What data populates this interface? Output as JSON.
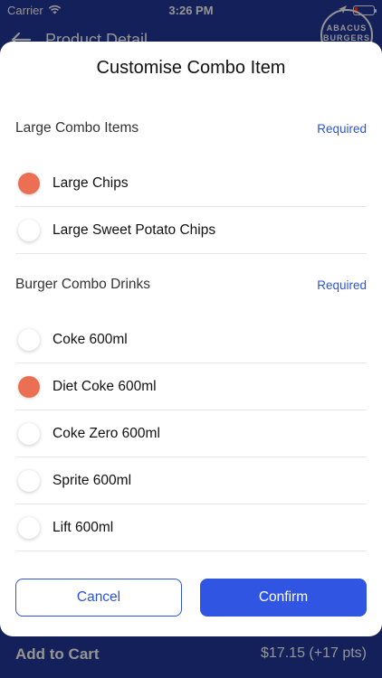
{
  "status_bar": {
    "carrier": "Carrier",
    "time": "3:26 PM"
  },
  "background": {
    "header_title": "Product Detail",
    "logo_text_top": "ABACUS",
    "logo_text_bottom": "BURGERS",
    "add_to_cart": "Add to Cart",
    "price": "$17.15 (+17 pts)"
  },
  "modal": {
    "title": "Customise Combo Item",
    "sections": [
      {
        "name": "Large Combo Items",
        "required": "Required",
        "options": [
          {
            "label": "Large Chips",
            "selected": true
          },
          {
            "label": "Large Sweet Potato Chips",
            "selected": false
          }
        ]
      },
      {
        "name": "Burger Combo Drinks",
        "required": "Required",
        "options": [
          {
            "label": "Coke 600ml",
            "selected": false
          },
          {
            "label": "Diet Coke 600ml",
            "selected": true
          },
          {
            "label": "Coke Zero 600ml",
            "selected": false
          },
          {
            "label": "Sprite 600ml",
            "selected": false
          },
          {
            "label": "Lift 600ml",
            "selected": false
          }
        ]
      }
    ],
    "cancel_label": "Cancel",
    "confirm_label": "Confirm"
  },
  "colors": {
    "accent": "#2f55e2",
    "selected_radio": "#ea6f53",
    "background": "#24389a"
  },
  "icons": {
    "wifi": "wifi-icon",
    "back": "back-arrow-icon",
    "location": "location-arrow-icon",
    "battery": "battery-icon"
  }
}
